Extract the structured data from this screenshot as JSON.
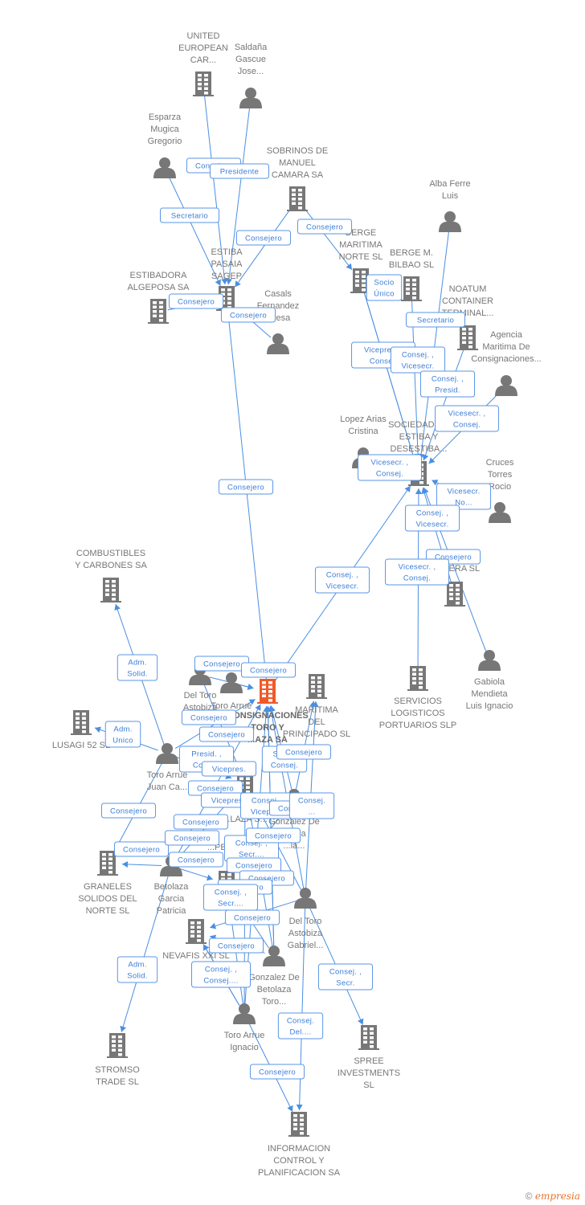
{
  "colors": {
    "edge": "#4a8fe2",
    "node": "#777777",
    "main_node": "#f05a28",
    "label_text": "#3b7dd8"
  },
  "nodes": [
    {
      "id": "n0",
      "type": "company",
      "label": [
        "UNITED",
        "EUROPEAN",
        "CAR..."
      ]
    },
    {
      "id": "n1",
      "type": "person",
      "label": [
        "Saldaña",
        "Gascue",
        "Jose..."
      ]
    },
    {
      "id": "n2",
      "type": "person",
      "label": [
        "Esparza",
        "Mugica",
        "Gregorio"
      ]
    },
    {
      "id": "n3",
      "type": "company",
      "label": [
        "SOBRINOS DE",
        "MANUEL",
        "CAMARA SA"
      ]
    },
    {
      "id": "n4",
      "type": "company",
      "label": [
        "ESTIBA",
        "PASAIA",
        "SAGEP"
      ]
    },
    {
      "id": "n5",
      "type": "company",
      "label": [
        "ESTIBADORA",
        "ALGEPOSA SA"
      ]
    },
    {
      "id": "n6",
      "type": "person",
      "label": [
        "Casals",
        "Fernandez",
        "...resa"
      ]
    },
    {
      "id": "n7",
      "type": "person",
      "label": [
        "Alba Ferre",
        "Luis"
      ]
    },
    {
      "id": "n8",
      "type": "company",
      "label": [
        "BERGE",
        "MARITIMA",
        "NORTE  SL"
      ]
    },
    {
      "id": "n9",
      "type": "company",
      "label": [
        "BERGE M.",
        "BILBAO  SL"
      ]
    },
    {
      "id": "n10",
      "type": "company",
      "label": [
        "NOATUM",
        "CONTAINER",
        "TERMINAL..."
      ]
    },
    {
      "id": "n11",
      "type": "person",
      "label": [
        "Agencia",
        "Maritima De",
        "Consignaciones..."
      ]
    },
    {
      "id": "n12",
      "type": "person",
      "label": [
        "Lopez Arias",
        "Cristina"
      ]
    },
    {
      "id": "n13",
      "type": "company",
      "label": [
        "SOCIEDAD DE",
        "ESTIBA Y",
        "DESESTIBA..."
      ]
    },
    {
      "id": "n14",
      "type": "person",
      "label": [
        "Cruces",
        "Torres",
        "Rocio"
      ]
    },
    {
      "id": "n15",
      "type": "company",
      "label": [
        "...RTERA SL"
      ]
    },
    {
      "id": "n16",
      "type": "company",
      "label": [
        "SERVICIOS",
        "LOGISTICOS",
        "PORTUARIOS  SLP"
      ]
    },
    {
      "id": "n17",
      "type": "person",
      "label": [
        "Gabiola",
        "Mendieta",
        "Luis Ignacio"
      ]
    },
    {
      "id": "n18",
      "type": "company",
      "label": [
        "COMBUSTIBLES",
        "Y CARBONES SA"
      ]
    },
    {
      "id": "n19",
      "type": "company",
      "label": [
        "LUSAGI 52 SL"
      ]
    },
    {
      "id": "n20",
      "type": "main",
      "label": [
        "CONSIGNACIONES",
        "TORO Y",
        "...AZA SA"
      ]
    },
    {
      "id": "n21",
      "type": "company",
      "label": [
        "MARITIMA",
        "DEL",
        "PRINCIPADO SL"
      ]
    },
    {
      "id": "n22",
      "type": "person",
      "label": [
        "Del Toro",
        "Astobiza",
        "M..."
      ]
    },
    {
      "id": "n23",
      "type": "person",
      "label": [
        "Toro Arrue"
      ]
    },
    {
      "id": "n24",
      "type": "person",
      "label": [
        "Toro Arrue",
        "Juan Ca..."
      ]
    },
    {
      "id": "n25",
      "type": "company",
      "label": [
        "GRANELES",
        "SOLIDOS DEL",
        "NORTE SL"
      ]
    },
    {
      "id": "n26",
      "type": "person",
      "label": [
        "Betolaza",
        "Garcia",
        "Patricia"
      ]
    },
    {
      "id": "n27",
      "type": "company",
      "label": [
        "NEVAFIS XXI SL"
      ]
    },
    {
      "id": "n28",
      "type": "person",
      "label": [
        "Del Toro",
        "Astobiza",
        "Gabriel..."
      ]
    },
    {
      "id": "n29",
      "type": "person",
      "label": [
        "Gonzalez De",
        "Betolaza",
        "Toro..."
      ]
    },
    {
      "id": "n30",
      "type": "person",
      "label": [
        "Toro Arrue",
        "Ignacio"
      ]
    },
    {
      "id": "n31",
      "type": "company",
      "label": [
        "STROMSO",
        "TRADE SL"
      ]
    },
    {
      "id": "n32",
      "type": "company",
      "label": [
        "SPREE",
        "INVESTMENTS",
        "SL"
      ]
    },
    {
      "id": "n33",
      "type": "company",
      "label": [
        "INFORMACION",
        "CONTROL Y",
        "PLANIFICACION SA"
      ]
    },
    {
      "id": "n34",
      "type": "company",
      "label": [
        "...LAZA S..."
      ]
    },
    {
      "id": "n35",
      "type": "person",
      "label": [
        "Gonzalez De",
        "...laza",
        "...la..."
      ]
    },
    {
      "id": "n36",
      "type": "company",
      "label": [
        "...PEZO..."
      ]
    }
  ],
  "edges": [
    {
      "from": "n0",
      "to": "n4",
      "role": [
        "Consejero"
      ]
    },
    {
      "from": "n1",
      "to": "n4",
      "role": [
        "Presidente"
      ]
    },
    {
      "from": "n2",
      "to": "n4",
      "role": [
        "Secretario"
      ]
    },
    {
      "from": "n3",
      "to": "n4",
      "role": [
        "Consejero"
      ]
    },
    {
      "from": "n3",
      "to": "n8",
      "role": [
        "Consejero"
      ]
    },
    {
      "from": "n5",
      "to": "n4",
      "role": [
        "Consejero"
      ]
    },
    {
      "from": "n6",
      "to": "n4",
      "role": [
        "Consejero"
      ]
    },
    {
      "from": "n20",
      "to": "n4",
      "role": [
        "Consejero"
      ]
    },
    {
      "from": "n8",
      "to": "n13",
      "role": [
        "Socio",
        "Único"
      ]
    },
    {
      "from": "n8",
      "to": "n13",
      "role": [
        "Vicepres. ,",
        "Consej."
      ]
    },
    {
      "from": "n9",
      "to": "n13",
      "role": [
        "Consej. ,",
        "Vicesecr."
      ]
    },
    {
      "from": "n7",
      "to": "n13",
      "role": [
        "Secretario"
      ]
    },
    {
      "from": "n10",
      "to": "n13",
      "role": [
        "Consej. ,",
        "Presid."
      ]
    },
    {
      "from": "n11",
      "to": "n13",
      "role": [
        "Vicesecr. ,",
        "Consej."
      ]
    },
    {
      "from": "n12",
      "to": "n13",
      "role": [
        "Vicesecr. ,",
        "Consej."
      ]
    },
    {
      "from": "n14",
      "to": "n13",
      "role": [
        "Vicesecr.",
        "No..."
      ]
    },
    {
      "from": "n15",
      "to": "n13",
      "role": [
        "Consej. ,",
        "Vicesecr."
      ]
    },
    {
      "from": "n17",
      "to": "n13",
      "role": [
        "Consejero"
      ]
    },
    {
      "from": "n16",
      "to": "n13",
      "role": [
        "Vicesecr. ,",
        "Consej."
      ]
    },
    {
      "from": "n20",
      "to": "n13",
      "role": [
        "Consej. ,",
        "Vicesecr."
      ]
    },
    {
      "from": "n24",
      "to": "n18",
      "role": [
        "Adm.",
        "Solid."
      ]
    },
    {
      "from": "n24",
      "to": "n19",
      "role": [
        "Adm.",
        "Unico"
      ]
    },
    {
      "from": "n24",
      "to": "n25",
      "role": [
        "Consejero"
      ]
    },
    {
      "from": "n26",
      "to": "n25",
      "role": [
        "Consejero"
      ]
    },
    {
      "from": "n26",
      "to": "n31",
      "role": [
        "Adm.",
        "Solid."
      ]
    },
    {
      "from": "n28",
      "to": "n32",
      "role": [
        "Consej. ,",
        "Secr."
      ]
    },
    {
      "from": "n28",
      "to": "n33",
      "role": [
        "Consej.",
        "Del...."
      ]
    },
    {
      "from": "n30",
      "to": "n33",
      "role": [
        "Consejero"
      ]
    },
    {
      "from": "n22",
      "to": "n20",
      "role": [
        "Consejero"
      ]
    },
    {
      "from": "n23",
      "to": "n20",
      "role": [
        "Consejero"
      ]
    },
    {
      "from": "n22",
      "to": "n34",
      "role": [
        "Consejero"
      ]
    },
    {
      "from": "n24",
      "to": "n34",
      "role": [
        "Consejero"
      ]
    },
    {
      "from": "n24",
      "to": "n20",
      "role": [
        "Presid. ,",
        "Consej."
      ]
    },
    {
      "from": "n26",
      "to": "n20",
      "role": [
        "Vicepres."
      ]
    },
    {
      "from": "n28",
      "to": "n20",
      "role": [
        "Secr. ,",
        "Consej."
      ]
    },
    {
      "from": "n28",
      "to": "n21",
      "role": [
        "Consejero"
      ]
    },
    {
      "from": "n26",
      "to": "n34",
      "role": [
        "Consejero"
      ]
    },
    {
      "from": "n29",
      "to": "n20",
      "role": [
        "Vicepres."
      ]
    },
    {
      "from": "n35",
      "to": "n20",
      "role": [
        "Consej. ,",
        "Vicepres."
      ]
    },
    {
      "from": "n35",
      "to": "n21",
      "role": [
        "Consejero"
      ]
    },
    {
      "from": "n28",
      "to": "n34",
      "role": [
        "Consej.",
        "..."
      ]
    },
    {
      "from": "n30",
      "to": "n34",
      "role": [
        "Consejero"
      ]
    },
    {
      "from": "n30",
      "to": "n36",
      "role": [
        "Consejero"
      ]
    },
    {
      "from": "n26",
      "to": "n36",
      "role": [
        "Consejero"
      ]
    },
    {
      "from": "n29",
      "to": "n36",
      "role": [
        "Consej. ,",
        "Secr...."
      ]
    },
    {
      "from": "n35",
      "to": "n36",
      "role": [
        "Consejero"
      ]
    },
    {
      "from": "n29",
      "to": "n27",
      "role": [
        "Consejero"
      ]
    },
    {
      "from": "n28",
      "to": "n27",
      "role": [
        "Consejero"
      ]
    },
    {
      "from": "n30",
      "to": "n27",
      "role": [
        "Consejero"
      ]
    },
    {
      "from": "n29",
      "to": "n34",
      "role": [
        "Consej. ,",
        "Secr...."
      ]
    },
    {
      "from": "n30",
      "to": "n20",
      "role": [
        "Consejero"
      ]
    },
    {
      "from": "n29",
      "to": "n20",
      "role": [
        "Consejero"
      ]
    },
    {
      "from": "n30",
      "to": "n27",
      "role": [
        "Consej. ,",
        "Consej...."
      ]
    }
  ],
  "footer": {
    "copyright": "©",
    "brand": "empresia"
  }
}
